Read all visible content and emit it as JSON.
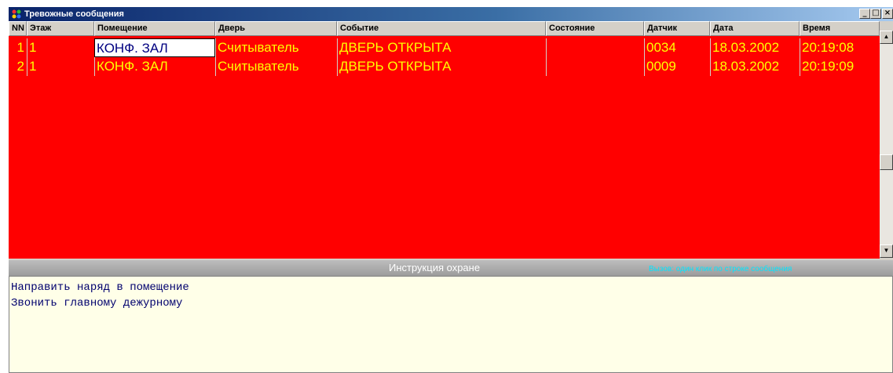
{
  "window": {
    "title": "Тревожные сообщения",
    "controls": {
      "minimize": "_",
      "maximize": "□",
      "close": "×"
    }
  },
  "table": {
    "columns": [
      "NN",
      "Этаж",
      "Помещение",
      "Дверь",
      "Событие",
      "Состояние",
      "Датчик",
      "Дата",
      "Время"
    ],
    "rows": [
      {
        "nn": "1",
        "floor": "1",
        "room": "КОНФ. ЗАЛ",
        "door": "Считыватель",
        "event": "ДВЕРЬ ОТКРЫТА",
        "state": "",
        "sensor": "0034",
        "date": "18.03.2002",
        "time": "20:19:08"
      },
      {
        "nn": "2",
        "floor": "1",
        "room": "КОНФ. ЗАЛ",
        "door": "Считыватель",
        "event": "ДВЕРЬ ОТКРЫТА",
        "state": "",
        "sensor": "0009",
        "date": "18.03.2002",
        "time": "20:19:09"
      }
    ],
    "selected_cell": "row1-room"
  },
  "instructions": {
    "title": "Инструкция охране",
    "hint": "Вызов:  один клик по строке сообщения",
    "lines": [
      "Направить наряд в помещение",
      "Звонить главному дежурному"
    ]
  },
  "colors": {
    "alarm_background": "#ff0000",
    "alarm_text": "#ffff00",
    "instruction_text": "#00006e",
    "hint_text": "#00e5ff"
  }
}
